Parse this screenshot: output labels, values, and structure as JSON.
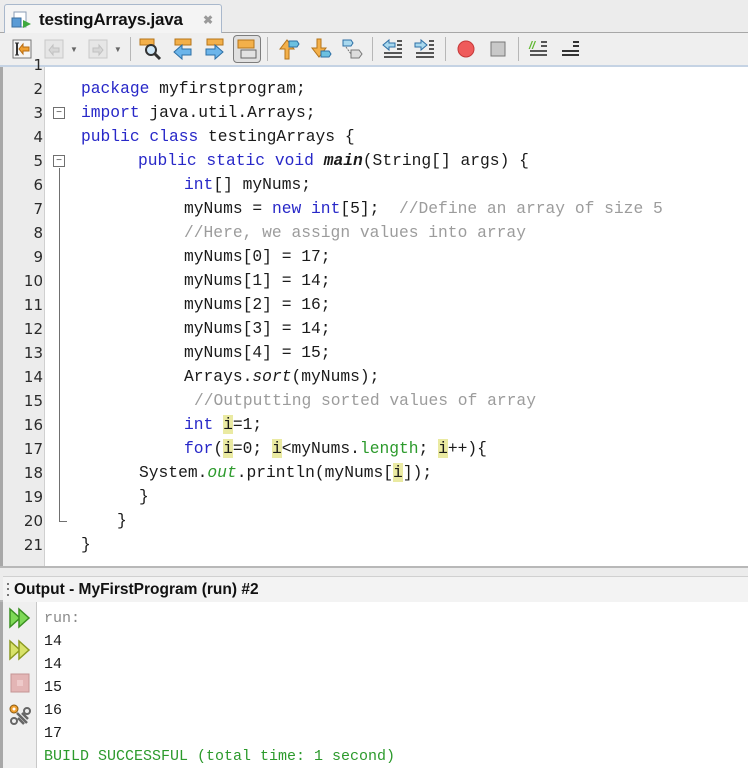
{
  "tab": {
    "title": "testingArrays.java",
    "close_icon": "close-icon"
  },
  "toolbar": {
    "buttons": [
      {
        "name": "last-edit-icon",
        "enabled": true
      },
      {
        "name": "back-icon",
        "enabled": false
      },
      {
        "name": "forward-icon",
        "enabled": false
      },
      {
        "name": "find-selection-icon",
        "enabled": true
      },
      {
        "name": "find-previous-icon",
        "enabled": true
      },
      {
        "name": "find-next-icon",
        "enabled": true
      },
      {
        "name": "toggle-highlight-search-icon",
        "enabled": true,
        "active": true
      },
      {
        "name": "previous-bookmark-icon",
        "enabled": true
      },
      {
        "name": "next-bookmark-icon",
        "enabled": true
      },
      {
        "name": "toggle-bookmark-icon",
        "enabled": true
      },
      {
        "name": "shift-left-icon",
        "enabled": true
      },
      {
        "name": "shift-right-icon",
        "enabled": true
      },
      {
        "name": "start-macro-icon",
        "enabled": true
      },
      {
        "name": "stop-macro-icon",
        "enabled": true
      },
      {
        "name": "comment-icon",
        "enabled": true
      },
      {
        "name": "uncomment-icon",
        "enabled": true
      }
    ]
  },
  "editor": {
    "partial_line_number": "1",
    "lines": [
      {
        "n": "2"
      },
      {
        "n": "3"
      },
      {
        "n": "4"
      },
      {
        "n": "5"
      },
      {
        "n": "6"
      },
      {
        "n": "7"
      },
      {
        "n": "8"
      },
      {
        "n": "9"
      },
      {
        "n": "10"
      },
      {
        "n": "11"
      },
      {
        "n": "12"
      },
      {
        "n": "13"
      },
      {
        "n": "14"
      },
      {
        "n": "15"
      },
      {
        "n": "16"
      },
      {
        "n": "17"
      },
      {
        "n": "18"
      },
      {
        "n": "19"
      },
      {
        "n": "20"
      },
      {
        "n": "21"
      }
    ],
    "tokens": {
      "l2": [
        "package",
        " myfirstprogram;"
      ],
      "l3": [
        "import",
        " java.util.Arrays;"
      ],
      "l4": [
        "public",
        " ",
        "class",
        " testingArrays {"
      ],
      "l5": [
        "public",
        " ",
        "static",
        " ",
        "void",
        " ",
        "main",
        "(String[] args) {"
      ],
      "l6": [
        "int",
        "[] myNums;"
      ],
      "l7": [
        "myNums = ",
        "new",
        " ",
        "int",
        "[5];  ",
        "//Define an array of size 5"
      ],
      "l8": [
        "//Here, we assign values into array"
      ],
      "l9": [
        "myNums[0] = 17;"
      ],
      "l10": [
        "myNums[1] = 14;"
      ],
      "l11": [
        "myNums[2] = 16;"
      ],
      "l12": [
        "myNums[3] = 14;"
      ],
      "l13": [
        "myNums[4] = 15;"
      ],
      "l14": [
        "Arrays.",
        "sort",
        "(myNums);"
      ],
      "l15": [
        "//Outputting sorted values of array"
      ],
      "l16": [
        "int",
        " ",
        "i",
        "=1;"
      ],
      "l17": [
        "for",
        "(",
        "i",
        "=0; ",
        "i",
        "<myNums.",
        "length",
        "; ",
        "i",
        "++){"
      ],
      "l18": [
        "System.",
        "out",
        ".println(myNums[",
        "i",
        "]);"
      ],
      "l19": [
        "}"
      ],
      "l20": [
        "}"
      ],
      "l21": [
        "}"
      ]
    }
  },
  "output": {
    "title": "Output - MyFirstProgram (run) #2",
    "side_buttons": [
      "rerun-icon",
      "rerun-with-options-icon",
      "stop-icon",
      "settings-icon"
    ],
    "lines": [
      "run:",
      "14",
      "14",
      "15",
      "16",
      "17",
      "BUILD SUCCESSFUL (total time: 1 second)"
    ]
  },
  "colors": {
    "keyword": "#2828c8",
    "comment": "#9c9c9c",
    "field": "#2c9a2c",
    "highlight": "#eaeaa2",
    "build_success": "#2c9a2c"
  }
}
